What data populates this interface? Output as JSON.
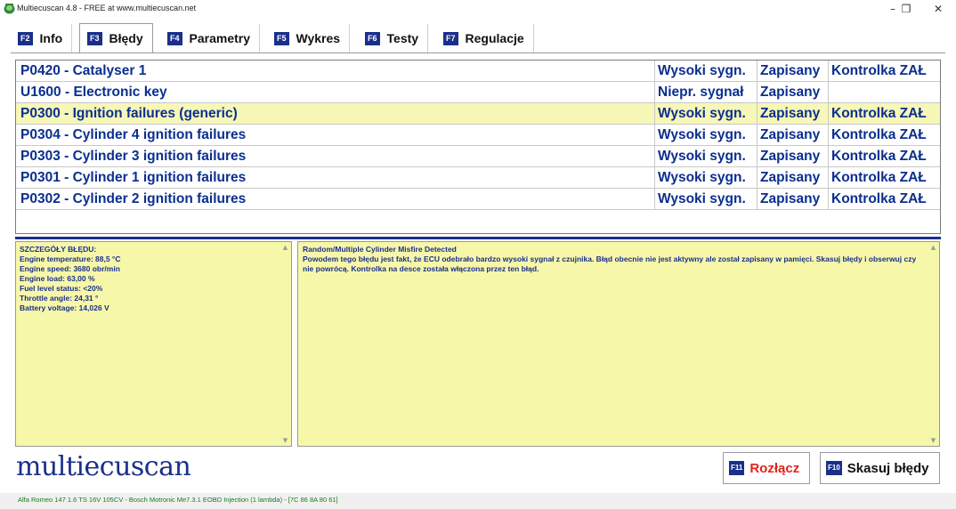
{
  "window": {
    "title": "Multiecuscan 4.8 - FREE at www.multiecuscan.net",
    "minimize_glyph": "–",
    "maximize_glyph": "❐",
    "close_glyph": "✕",
    "icon": "multiecuscan-app-icon"
  },
  "tabs": [
    {
      "key": "F2",
      "label": "Info"
    },
    {
      "key": "F3",
      "label": "Błędy"
    },
    {
      "key": "F4",
      "label": "Parametry"
    },
    {
      "key": "F5",
      "label": "Wykres"
    },
    {
      "key": "F6",
      "label": "Testy"
    },
    {
      "key": "F7",
      "label": "Regulacje"
    }
  ],
  "active_tab": "Błędy",
  "errors": {
    "rows": [
      {
        "description": "P0420 - Catalyser 1",
        "signal": "Wysoki sygn.",
        "status": "Zapisany",
        "lamp": "Kontrolka ZAŁ"
      },
      {
        "description": "U1600 - Electronic key",
        "signal": "Niepr. sygnał",
        "status": "Zapisany",
        "lamp": ""
      },
      {
        "description": "P0300 - Ignition failures (generic)",
        "signal": "Wysoki sygn.",
        "status": "Zapisany",
        "lamp": "Kontrolka ZAŁ"
      },
      {
        "description": "P0304 - Cylinder 4 ignition failures",
        "signal": "Wysoki sygn.",
        "status": "Zapisany",
        "lamp": "Kontrolka ZAŁ"
      },
      {
        "description": "P0303 - Cylinder 3 ignition failures",
        "signal": "Wysoki sygn.",
        "status": "Zapisany",
        "lamp": "Kontrolka ZAŁ"
      },
      {
        "description": "P0301 - Cylinder 1 ignition failures",
        "signal": "Wysoki sygn.",
        "status": "Zapisany",
        "lamp": "Kontrolka ZAŁ"
      },
      {
        "description": "P0302 - Cylinder 2 ignition failures",
        "signal": "Wysoki sygn.",
        "status": "Zapisany",
        "lamp": "Kontrolka ZAŁ"
      }
    ],
    "selected_index": 2
  },
  "details": {
    "lines": [
      "SZCZEGÓŁY BŁĘDU:",
      "Engine temperature: 88,5 °C",
      "Engine speed: 3680 obr/min",
      "Engine load: 63,00 %",
      "Fuel level status: <20%",
      "Throttle angle: 24,31 °",
      "Battery voltage: 14,026 V"
    ]
  },
  "description": {
    "heading": "Random/Multiple Cylinder Misfire Detected",
    "body": "Powodem tego błędu jest fakt, że ECU odebrało bardzo wysoki sygnał z czujnika. Błąd obecnie nie jest aktywny ale został zapisany w pamięci. Skasuj błędy i obserwuj czy nie powrócą. Kontrolka na desce została włączona przez ten błąd."
  },
  "logo": {
    "text": "multiecuscan"
  },
  "buttons": {
    "disconnect": {
      "key": "F11",
      "label": "Rozłącz"
    },
    "clear": {
      "key": "F10",
      "label": "Skasuj błędy"
    }
  },
  "status": {
    "text": "Alfa Romeo 147 1.6 TS 16V 105CV - Bosch Motronic Me7.3.1 EOBD Injection (1 lambda) - [7C 86 8A 80 61]"
  },
  "colors": {
    "accent_blue": "#1a2f8a",
    "selected_row": "#f7f7b7",
    "detail_bg": "#f7f7aa",
    "disconnect_red": "#e3221c",
    "status_green": "#1a7a1a"
  },
  "scroll": {
    "up_glyph": "▲",
    "down_glyph": "▼"
  }
}
